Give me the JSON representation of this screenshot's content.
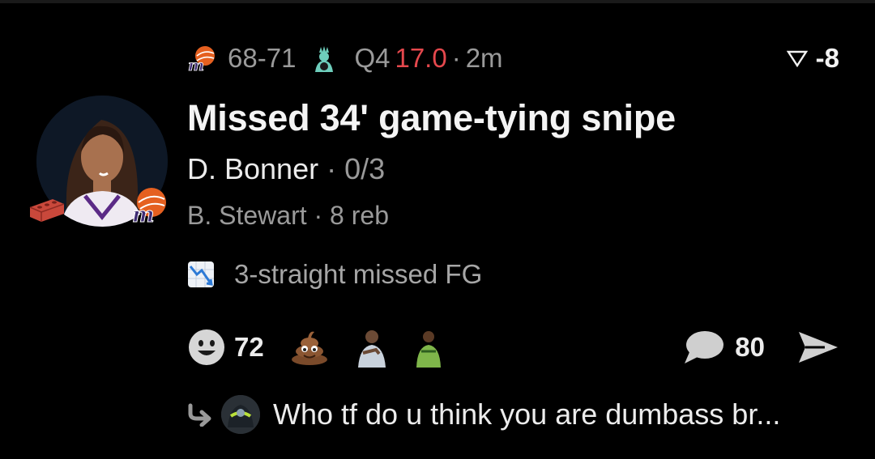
{
  "game": {
    "away_score": "68",
    "score_sep": "-",
    "home_score": "71",
    "quarter": "Q4",
    "clock": "17.0",
    "dot": "·",
    "time_ago": "2m",
    "spread": "-8",
    "away_team_icon": "mercury-logo-icon",
    "home_team_icon": "liberty-logo-icon"
  },
  "post": {
    "headline": "Missed 34' game-tying snipe",
    "player_name": "D. Bonner",
    "player_dot": " · ",
    "player_stat": "0/3",
    "assist_line": "B. Stewart · 8 reb",
    "streak_text": "3-straight missed FG",
    "streak_icon": "chart-decreasing-icon",
    "badge_icon": "brick-icon"
  },
  "reactions": {
    "count": "72",
    "emojis": [
      "pile-of-poo-icon",
      "person-gesture-icon",
      "person-green-jersey-icon"
    ]
  },
  "comments": {
    "count": "80"
  },
  "reply": {
    "text": "Who tf do u think you are dumbass br..."
  },
  "colors": {
    "background": "#000000",
    "primary_text": "#f2f2f2",
    "secondary_text": "#9a9a9a",
    "clock_red": "#e5484d"
  }
}
